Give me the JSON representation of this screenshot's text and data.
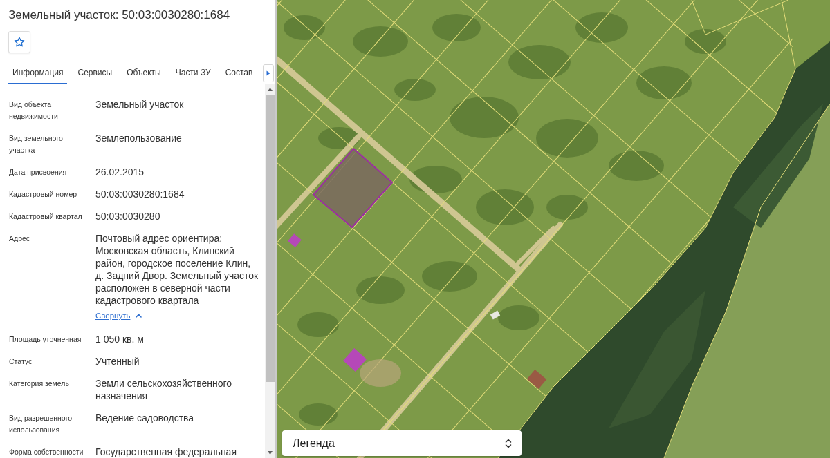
{
  "panel": {
    "title": "Земельный участок: 50:03:0030280:1684",
    "tabs": [
      {
        "label": "Информация",
        "selected": true
      },
      {
        "label": "Сервисы",
        "selected": false
      },
      {
        "label": "Объекты",
        "selected": false
      },
      {
        "label": "Части ЗУ",
        "selected": false
      },
      {
        "label": "Состав",
        "selected": false
      }
    ],
    "properties": [
      {
        "label": "Вид объекта недвижимости",
        "value": "Земельный участок"
      },
      {
        "label": "Вид земельного участка",
        "value": "Землепользование"
      },
      {
        "label": "Дата присвоения",
        "value": "26.02.2015"
      },
      {
        "label": "Кадастровый номер",
        "value": "50:03:0030280:1684"
      },
      {
        "label": "Кадастровый квартал",
        "value": "50:03:0030280"
      },
      {
        "label": "Адрес",
        "value": "Почтовый адрес ориентира: Московская область, Клинский район, городское поселение Клин, д. Задний Двор. Земельный участок расположен в северной части кадастрового квартала",
        "link": "Свернуть"
      },
      {
        "label": "Площадь уточненная",
        "value": "1 050 кв. м"
      },
      {
        "label": "Статус",
        "value": "Учтенный"
      },
      {
        "label": "Категория земель",
        "value": "Земли сельскохозяйственного назначения"
      },
      {
        "label": "Вид разрешенного использования",
        "value": "Ведение садоводства"
      },
      {
        "label": "Форма собственности",
        "value": "Государственная федеральная"
      }
    ]
  },
  "map": {
    "legend": "Легенда"
  }
}
